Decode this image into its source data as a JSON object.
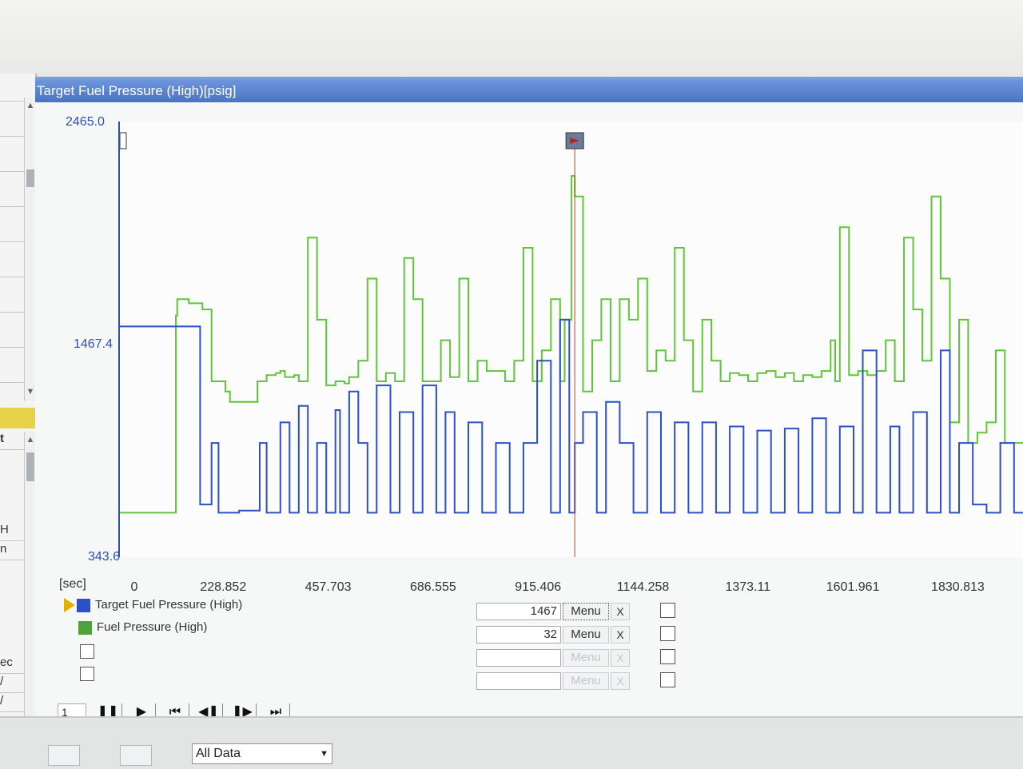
{
  "window": {
    "title": "Target Fuel Pressure (High)[psig]"
  },
  "left_panel": {
    "cells": [
      "H",
      "n",
      "ec",
      "/",
      "/"
    ],
    "selected_cell": "t"
  },
  "chart_data": {
    "type": "line",
    "title": "Target Fuel Pressure (High)[psig]",
    "xlabel": "[sec]",
    "ylabel": "",
    "ylim": [
      343.6,
      2465.0
    ],
    "y_ticks": [
      "2465.0",
      "1467.4",
      "343.6"
    ],
    "xlim": [
      0,
      1973
    ],
    "x_ticks": [
      "0",
      "228.852",
      "457.703",
      "686.555",
      "915.406",
      "1144.258",
      "1373.11",
      "1601.961",
      "1830.813"
    ],
    "cursor_x": 992,
    "grid": false,
    "legend_position": "bottom-left",
    "series": [
      {
        "name": "Target Fuel Pressure (High)",
        "color": "#2d4fc8",
        "x": [
          0,
          120,
          175,
          200,
          215,
          230,
          260,
          305,
          320,
          350,
          370,
          390,
          410,
          430,
          450,
          470,
          480,
          500,
          520,
          540,
          560,
          590,
          610,
          640,
          660,
          690,
          710,
          730,
          760,
          790,
          820,
          850,
          880,
          910,
          940,
          960,
          980,
          992,
          1010,
          1040,
          1060,
          1090,
          1120,
          1150,
          1180,
          1210,
          1240,
          1270,
          1300,
          1330,
          1360,
          1390,
          1420,
          1450,
          1480,
          1510,
          1540,
          1570,
          1600,
          1620,
          1650,
          1680,
          1700,
          1730,
          1760,
          1790,
          1810,
          1830,
          1860,
          1890,
          1920,
          1950,
          1973
        ],
        "values": [
          1467,
          1467,
          600,
          900,
          560,
          560,
          570,
          900,
          560,
          1000,
          560,
          1080,
          560,
          900,
          560,
          1060,
          560,
          1150,
          900,
          560,
          1180,
          560,
          1050,
          560,
          1180,
          560,
          1050,
          560,
          1000,
          560,
          900,
          560,
          900,
          1300,
          560,
          1500,
          560,
          900,
          1050,
          560,
          1100,
          900,
          560,
          1050,
          560,
          1000,
          560,
          1000,
          560,
          980,
          560,
          960,
          560,
          970,
          560,
          1020,
          560,
          980,
          560,
          1350,
          560,
          980,
          560,
          1050,
          560,
          1350,
          560,
          900,
          600,
          560,
          900,
          560,
          900
        ]
      },
      {
        "name": "Fuel Pressure (High)",
        "color": "#5fc53a",
        "x": [
          0,
          120,
          122,
          125,
          150,
          180,
          200,
          230,
          240,
          260,
          300,
          320,
          340,
          350,
          360,
          380,
          390,
          410,
          430,
          450,
          470,
          490,
          500,
          520,
          540,
          560,
          580,
          600,
          620,
          640,
          660,
          680,
          700,
          720,
          740,
          760,
          780,
          800,
          820,
          840,
          860,
          880,
          900,
          920,
          940,
          960,
          970,
          985,
          992,
          1010,
          1030,
          1050,
          1070,
          1090,
          1110,
          1130,
          1150,
          1170,
          1190,
          1210,
          1230,
          1250,
          1270,
          1290,
          1310,
          1330,
          1350,
          1370,
          1390,
          1410,
          1430,
          1450,
          1470,
          1490,
          1510,
          1530,
          1550,
          1560,
          1570,
          1590,
          1610,
          1630,
          1650,
          1670,
          1690,
          1710,
          1730,
          1750,
          1770,
          1790,
          1810,
          1830,
          1850,
          1870,
          1890,
          1910,
          1930,
          1950,
          1973
        ],
        "values": [
          560,
          560,
          1520,
          1600,
          1580,
          1550,
          1200,
          1150,
          1100,
          1100,
          1200,
          1230,
          1240,
          1250,
          1220,
          1230,
          1200,
          1900,
          1500,
          1180,
          1200,
          1190,
          1220,
          1300,
          1700,
          1200,
          1240,
          1200,
          1800,
          1600,
          1200,
          1200,
          1400,
          1220,
          1700,
          1200,
          1300,
          1250,
          1250,
          1200,
          1300,
          1850,
          1200,
          1350,
          1600,
          1200,
          1500,
          2200,
          2100,
          1150,
          1400,
          1600,
          1200,
          1600,
          1500,
          1700,
          1250,
          1350,
          1300,
          1850,
          1400,
          1150,
          1500,
          1300,
          1200,
          1240,
          1230,
          1200,
          1240,
          1250,
          1220,
          1240,
          1200,
          1230,
          1220,
          1250,
          1400,
          1200,
          1950,
          1230,
          1250,
          1230,
          1250,
          1400,
          1200,
          1900,
          1550,
          1300,
          2100,
          1700,
          1000,
          1500,
          900,
          950,
          1000,
          1350,
          900,
          900,
          900
        ]
      }
    ]
  },
  "legend": {
    "items": [
      {
        "label": "Target Fuel Pressure (High)",
        "color": "#2d4fc8",
        "value": "1467",
        "menu": "Menu",
        "close": "X",
        "active": true
      },
      {
        "label": "Fuel Pressure (High)",
        "color": "#4fa33a",
        "value": "32",
        "menu": "Menu",
        "close": "X",
        "active": false
      },
      {
        "label": "",
        "value": "",
        "menu": "Menu",
        "close": "X",
        "disabled": true
      },
      {
        "label": "",
        "value": "",
        "menu": "Menu",
        "close": "X",
        "disabled": true
      }
    ]
  },
  "transport": {
    "speed": "1",
    "buttons": [
      "pause-icon",
      "play-icon",
      "skip-to-start-icon",
      "step-back-icon",
      "step-forward-icon",
      "skip-to-end-icon"
    ],
    "glyphs": [
      "❚❚",
      "▶",
      "⏮",
      "◀❚",
      "❚▶",
      "⏭"
    ]
  },
  "bottom": {
    "data_filter": "All Data"
  }
}
